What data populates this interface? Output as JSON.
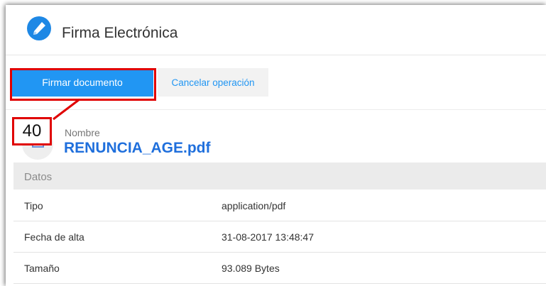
{
  "header": {
    "title": "Firma Electrónica",
    "icon": "pen-icon"
  },
  "toolbar": {
    "sign_label": "Firmar documento",
    "cancel_label": "Cancelar operación"
  },
  "annotation": {
    "step": "40",
    "color": "#e00000"
  },
  "file": {
    "name_label": "Nombre",
    "name": "RENUNCIA_AGE.pdf"
  },
  "details": {
    "section_title": "Datos",
    "rows": [
      {
        "label": "Tipo",
        "value": "application/pdf"
      },
      {
        "label": "Fecha de alta",
        "value": "31-08-2017 13:48:47"
      },
      {
        "label": "Tamaño",
        "value": "93.089 Bytes"
      }
    ]
  },
  "colors": {
    "accent": "#2196f3",
    "link": "#1f6fdc"
  }
}
